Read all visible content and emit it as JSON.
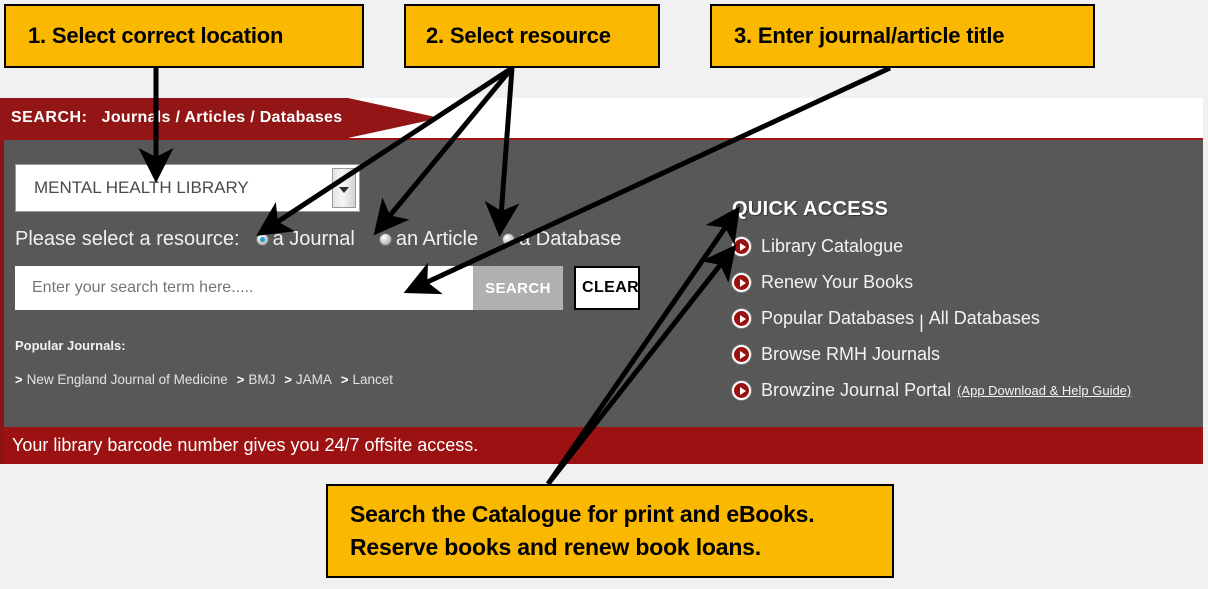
{
  "annotations": {
    "step1": "1. Select correct location",
    "step2": "2. Select resource",
    "step3": "3. Enter journal/article title",
    "catalogue_note_line1": "Search the Catalogue for print and eBooks.",
    "catalogue_note_line2": "Reserve books and renew book loans."
  },
  "banner": {
    "label": "SEARCH:",
    "title": "Journals / Articles / Databases"
  },
  "location": {
    "selected": "MENTAL HEALTH LIBRARY",
    "dropdown_icon": "chevron-down-icon"
  },
  "resource": {
    "label": "Please select a resource:",
    "options": [
      {
        "label": "a Journal",
        "selected": true
      },
      {
        "label": "an Article",
        "selected": false
      },
      {
        "label": "a Database",
        "selected": false
      }
    ]
  },
  "search": {
    "value": "",
    "placeholder": "Enter your search term here.....",
    "search_button": "SEARCH",
    "clear_button": "CLEAR"
  },
  "popular_journals": {
    "label": "Popular Journals:",
    "items": [
      "New England Journal of Medicine",
      "BMJ",
      "JAMA",
      "Lancet"
    ],
    "bullet": ">"
  },
  "quick_access": {
    "title": "QUICK ACCESS",
    "items": [
      {
        "label": "Library Catalogue"
      },
      {
        "label": "Renew Your Books"
      },
      {
        "label": "Popular Databases",
        "separator": "|",
        "label2": "All Databases"
      },
      {
        "label": "Browse RMH Journals"
      },
      {
        "label": "Browzine Journal Portal",
        "sub": "(App Download & Help Guide)"
      }
    ]
  },
  "bottom_bar": {
    "text": "Your library barcode number gives you 24/7 offsite access."
  },
  "colors": {
    "callout_yellow": "#FBB800",
    "brand_red": "#921616",
    "panel_gray": "#585858",
    "bottom_red": "#9C1212",
    "radio_selected_blue": "#1F9FD2"
  }
}
